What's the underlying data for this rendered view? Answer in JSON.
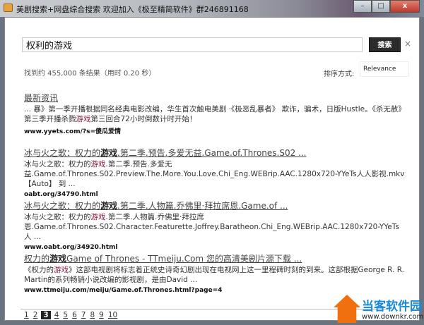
{
  "window": {
    "title": "美剧搜索+网盘综合搜索   欢迎加入《极至精简软件》群246891168",
    "minimize": "–",
    "maximize": "□",
    "close": "x"
  },
  "search": {
    "query": "权利的游戏",
    "button": "搜索",
    "clear": "×"
  },
  "stats": "找到约 455,000 条结果（用时 0.20 秒）",
  "sort": {
    "label": "排序方式:",
    "value": "Relevance"
  },
  "results": [
    {
      "title": "最新资讯",
      "snippet_pre": "... 暴》第一季开播根据同名经典电影改编，华生首次触电美剧 ·《极恶乱暴者》 欺诈，骗术，日版Hustle。《杀无赦》第三季开播杀戮",
      "snippet_hl": "游戏",
      "snippet_post": "第三回合72小时倒数计时开始！",
      "url": "www.yyets.com/?s=傻瓜爱情"
    },
    {
      "title_pre": "冰与火之歌：权力的",
      "title_b": "游戏",
      "title_post": ".第二季.预告.多爱无益.Game.of.Thrones.S02 ...",
      "snippet_pre": "冰与火之歌：权力的",
      "snippet_hl": "游戏",
      "snippet_post": ".第二季.预告.多爱无益.Game.of.Thrones.S02.Preview.The.More.You.Love.Chi_Eng.WEBrip.AAC.1280x720-YYeTs人人影视.mkv【Auto】 到 ...",
      "url": "oabt.org/34790.html"
    },
    {
      "title_pre": "冰与火之歌：权力的",
      "title_b": "游戏",
      "title_post": ".第二季.人物篇.乔佛里·拜拉席恩.Game.of ...",
      "snippet_pre": "冰与火之歌：权力的",
      "snippet_hl": "游戏",
      "snippet_post": ".第二季.人物篇.乔佛里·拜拉席恩.Game.of.Thrones.S02.Character.Featurette.Joffrey.Baratheon.Chi_Eng.WEBrip.AAC.1280x720-YYeTs 人 ...",
      "url": "www.oabt.org/34920.html"
    },
    {
      "title_pre": "权力的",
      "title_b": "游戏",
      "title_post": "Game of Thrones - TTmeiju.Com 您的高清美剧片源下载 ...",
      "snippet_pre": "《权力的",
      "snippet_hl": "游戏",
      "snippet_post": "》这部电视剧将标志着正统史诗奇幻剧出现在电视网上这一里程碑时刻的到来。这部根据George R. R. Martin的系列畅销小说改编的影视剧，是由David ...",
      "url": "www.ttmeiju.com/meiju/Game.of.Thrones.html?page=4"
    }
  ],
  "pages": [
    "1",
    "2",
    "3",
    "4",
    "5",
    "6",
    "7",
    "8",
    "9",
    "10"
  ],
  "current_page": "3",
  "watermark": {
    "title": "当客软件园",
    "url": "www.downkr.com"
  }
}
